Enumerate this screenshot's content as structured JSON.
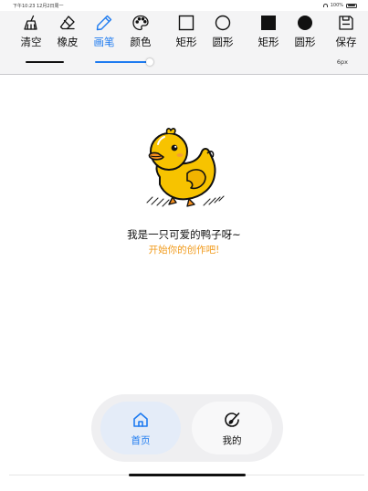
{
  "status_bar": {
    "time": "下午10:23  12月2日周一",
    "battery": "100%"
  },
  "toolbar": {
    "tools": [
      {
        "label": "清空",
        "icon": "broom-icon"
      },
      {
        "label": "橡皮",
        "icon": "eraser-icon"
      },
      {
        "label": "画笔",
        "icon": "pen-icon",
        "active": true
      },
      {
        "label": "颜色",
        "icon": "palette-icon"
      },
      {
        "label": "矩形",
        "icon": "rectangle-outline-icon"
      },
      {
        "label": "圆形",
        "icon": "circle-outline-icon"
      },
      {
        "label": "矩形",
        "icon": "rectangle-filled-icon"
      },
      {
        "label": "圆形",
        "icon": "circle-filled-icon"
      },
      {
        "label": "保存",
        "icon": "save-icon"
      }
    ],
    "active_color": "#1e7bf0"
  },
  "options": {
    "stroke_size": "6px"
  },
  "canvas": {
    "image": "duck-illustration",
    "caption": "我是一只可爱的鸭子呀~",
    "subcaption": "开始你的创作吧!"
  },
  "tabbar": {
    "tabs": [
      {
        "label": "首页",
        "icon": "home-icon",
        "selected": true
      },
      {
        "label": "我的",
        "icon": "brush-circle-icon",
        "selected": false
      }
    ]
  },
  "colors": {
    "accent": "#1e7bf0",
    "subcaption": "#f19a1a",
    "duck": "#f7c300"
  }
}
